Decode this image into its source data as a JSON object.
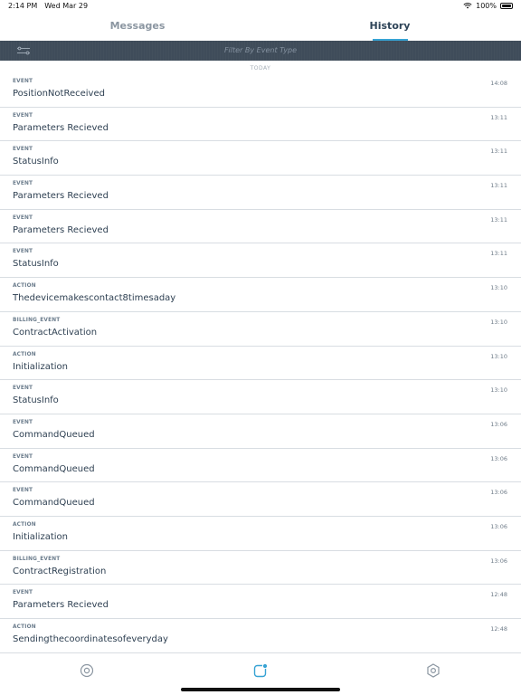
{
  "status_bar": {
    "time": "2:14 PM",
    "date": "Wed Mar 29",
    "battery": "100%"
  },
  "tabs": [
    {
      "label": "Messages",
      "active": false
    },
    {
      "label": "History",
      "active": true
    }
  ],
  "filter": {
    "placeholder": "Filter By Event Type"
  },
  "section": {
    "label": "TODAY"
  },
  "items": [
    {
      "type": "EVENT",
      "title": "PositionNotReceived",
      "time": "14:08"
    },
    {
      "type": "EVENT",
      "title": "Parameters Recieved",
      "time": "13:11"
    },
    {
      "type": "EVENT",
      "title": "StatusInfo",
      "time": "13:11"
    },
    {
      "type": "EVENT",
      "title": "Parameters Recieved",
      "time": "13:11"
    },
    {
      "type": "EVENT",
      "title": "Parameters Recieved",
      "time": "13:11"
    },
    {
      "type": "EVENT",
      "title": "StatusInfo",
      "time": "13:11"
    },
    {
      "type": "ACTION",
      "title": "Thedevicemakescontact8timesaday",
      "time": "13:10"
    },
    {
      "type": "BILLING_EVENT",
      "title": "ContractActivation",
      "time": "13:10"
    },
    {
      "type": "ACTION",
      "title": "Initialization",
      "time": "13:10"
    },
    {
      "type": "EVENT",
      "title": "StatusInfo",
      "time": "13:10"
    },
    {
      "type": "EVENT",
      "title": "CommandQueued",
      "time": "13:06"
    },
    {
      "type": "EVENT",
      "title": "CommandQueued",
      "time": "13:06"
    },
    {
      "type": "EVENT",
      "title": "CommandQueued",
      "time": "13:06"
    },
    {
      "type": "ACTION",
      "title": "Initialization",
      "time": "13:06"
    },
    {
      "type": "BILLING_EVENT",
      "title": "ContractRegistration",
      "time": "13:06"
    },
    {
      "type": "EVENT",
      "title": "Parameters Recieved",
      "time": "12:48"
    },
    {
      "type": "ACTION",
      "title": "Sendingthecoordinatesofeveryday",
      "time": "12:48"
    }
  ],
  "colors": {
    "accent": "#37a3d4",
    "filter_bar": "#3f4c5a",
    "text": "#2d3f51"
  },
  "icons": {
    "filter": "sliders-icon",
    "nav_left": "target-icon",
    "nav_mid": "notification-square-icon",
    "nav_right": "hexagon-settings-icon"
  }
}
